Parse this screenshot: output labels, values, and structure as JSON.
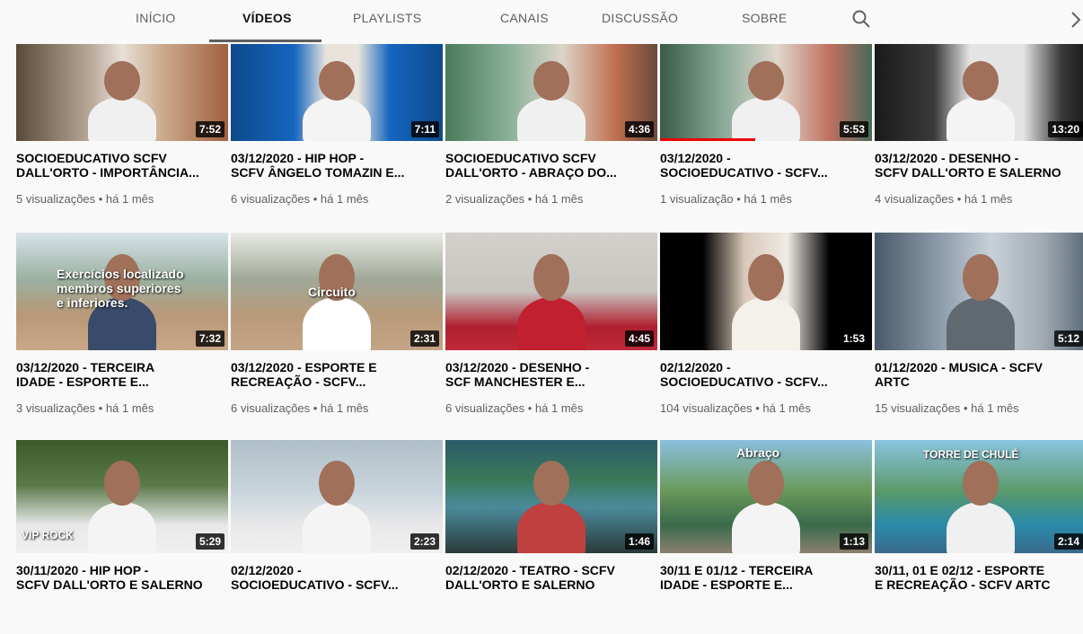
{
  "tabs": [
    {
      "label": "INÍCIO",
      "active": false
    },
    {
      "label": "VÍDEOS",
      "active": true
    },
    {
      "label": "PLAYLISTS",
      "active": false
    },
    {
      "label": "CANAIS",
      "active": false
    },
    {
      "label": "DISCUSSÃO",
      "active": false
    },
    {
      "label": "SOBRE",
      "active": false
    }
  ],
  "icons": {
    "search": "search-icon",
    "next": "chevron-right-icon"
  },
  "videos": [
    {
      "line1": "SOCIOEDUCATIVO SCFV",
      "line2": "DALL'ORTO - IMPORTÂNCIA...",
      "duration": "7:52",
      "meta": "5 visualizações • há 1 mês"
    },
    {
      "line1": "03/12/2020 - HIP HOP -",
      "line2": "SCFV ÂNGELO TOMAZIN E...",
      "duration": "7:11",
      "meta": "6 visualizações • há 1 mês"
    },
    {
      "line1": "SOCIOEDUCATIVO SCFV",
      "line2": "DALL'ORTO - ABRAÇO DO...",
      "duration": "4:36",
      "meta": "2 visualizações • há 1 mês"
    },
    {
      "line1": "03/12/2020 -",
      "line2": "SOCIOEDUCATIVO - SCFV...",
      "duration": "5:53",
      "meta": "1 visualização • há 1 mês",
      "watched": 0.45
    },
    {
      "line1": "03/12/2020 - DESENHO -",
      "line2": "SCFV DALL'ORTO E SALERNO",
      "duration": "13:20",
      "meta": "4 visualizações • há 1 mês"
    },
    {
      "line1": "03/12/2020 - TERCEIRA",
      "line2": "IDADE - ESPORTE E...",
      "duration": "7:32",
      "meta": "3 visualizações • há 1 mês",
      "overlay": [
        "Exercícios localizado",
        "membros superiores",
        "e inferiores."
      ]
    },
    {
      "line1": "03/12/2020 - ESPORTE E",
      "line2": "RECREAÇÃO - SCFV...",
      "duration": "2:31",
      "meta": "6 visualizações • há 1 mês",
      "overlay": [
        "Circuito"
      ]
    },
    {
      "line1": "03/12/2020 - DESENHO -",
      "line2": "SCF MANCHESTER E...",
      "duration": "4:45",
      "meta": "6 visualizações • há 1 mês"
    },
    {
      "line1": "02/12/2020 -",
      "line2": "SOCIOEDUCATIVO - SCFV...",
      "duration": "1:53",
      "meta": "104 visualizações • há 1 mês"
    },
    {
      "line1": "01/12/2020 - MUSICA - SCFV",
      "line2": "ARTC",
      "duration": "5:12",
      "meta": "15 visualizações • há 1 mês"
    },
    {
      "line1": "30/11/2020 - HIP HOP -",
      "line2": "SCFV DALL'ORTO E SALERNO",
      "duration": "5:29",
      "meta": "",
      "overlay": [
        "VIP ROCK"
      ]
    },
    {
      "line1": "02/12/2020 -",
      "line2": "SOCIOEDUCATIVO - SCFV...",
      "duration": "2:23",
      "meta": ""
    },
    {
      "line1": "02/12/2020 - TEATRO - SCFV",
      "line2": "DALL'ORTO E SALERNO",
      "duration": "1:46",
      "meta": ""
    },
    {
      "line1": "30/11 e 01/12 - TERCEIRA",
      "line2": "IDADE - ESPORTE E...",
      "duration": "1:13",
      "meta": "",
      "overlay": [
        "Abraço"
      ]
    },
    {
      "line1": "30/11, 01 e 02/12 - ESPORTE",
      "line2": "E RECREAÇÃO - SCFV ARTC",
      "duration": "2:14",
      "meta": "",
      "overlay": [
        "TORRE DE CHULÉ"
      ]
    }
  ],
  "colors": {
    "background": "#f9f9f9",
    "progress": "#ee0000",
    "title": "#030303",
    "meta": "#606060"
  }
}
